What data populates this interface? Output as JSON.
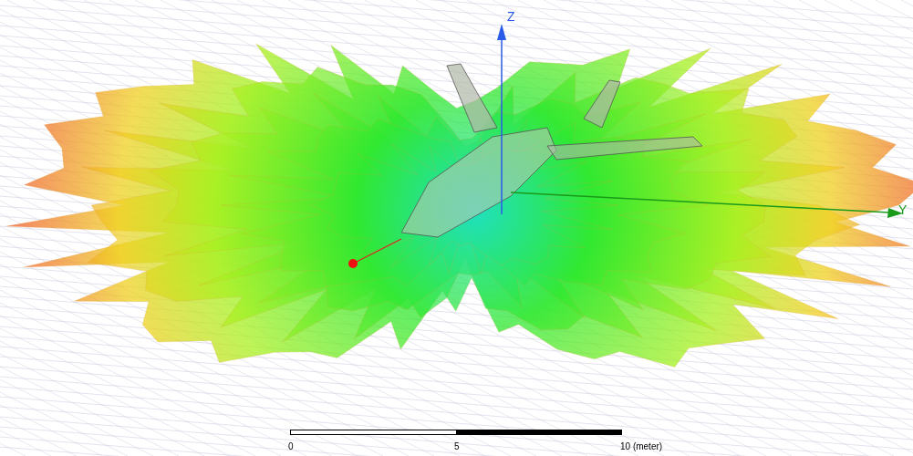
{
  "viewport": {
    "axes": [
      {
        "kind": "z",
        "label": "Z"
      },
      {
        "kind": "y",
        "label": "Y"
      }
    ]
  },
  "scale_bar": {
    "ticks": [
      "0",
      "5",
      "10 (meter)"
    ]
  }
}
